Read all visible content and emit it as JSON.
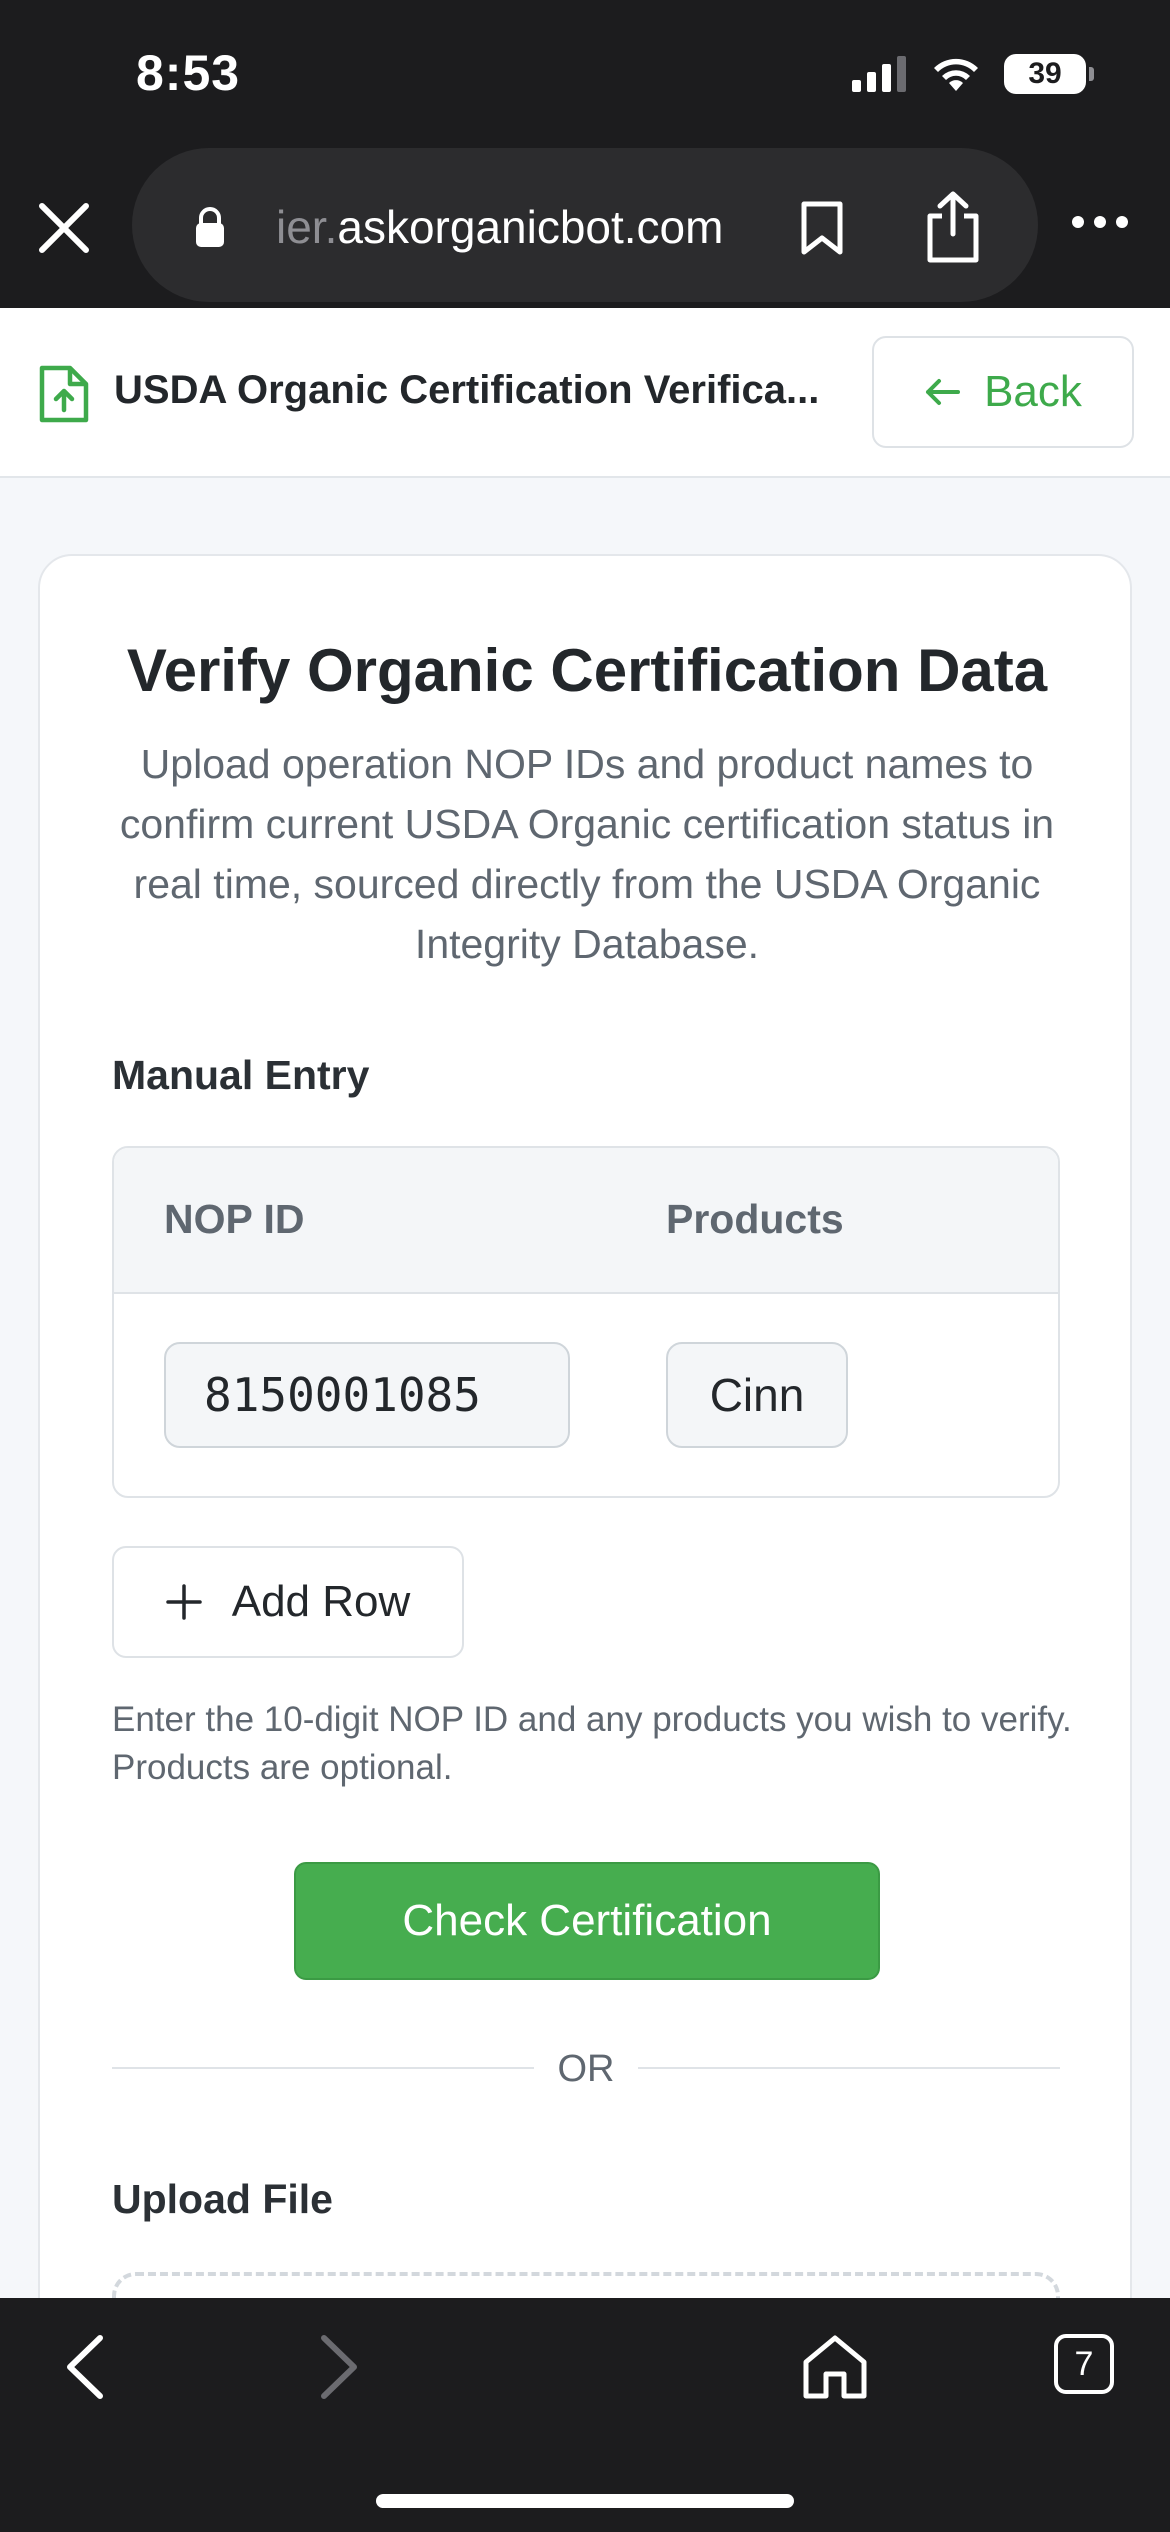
{
  "status_bar": {
    "time": "8:53",
    "battery": "39"
  },
  "browser": {
    "url_prefix": "ier.",
    "url_domain": "askorganicbot.com"
  },
  "header": {
    "title": "USDA Organic Certification Verifica...",
    "back_label": "Back"
  },
  "card": {
    "title": "Verify Organic Certification Data",
    "subtitle": "Upload operation NOP IDs and product names to confirm current USDA Organic certification status in real time, sourced directly from the USDA Organic Integrity Database."
  },
  "manual_entry": {
    "label": "Manual Entry",
    "columns": [
      "NOP ID",
      "Products"
    ],
    "rows": [
      {
        "nop_id": "8150001085",
        "products": "Cinn"
      }
    ],
    "add_row_label": "Add Row",
    "hint": "Enter the 10-digit NOP ID and any products you wish to verify. Products are optional."
  },
  "check_button_label": "Check Certification",
  "divider_text": "OR",
  "upload": {
    "label": "Upload File"
  },
  "toolbar": {
    "tab_count": "7"
  },
  "colors": {
    "accent": "#46ad4f",
    "chrome": "#1c1c1e"
  }
}
